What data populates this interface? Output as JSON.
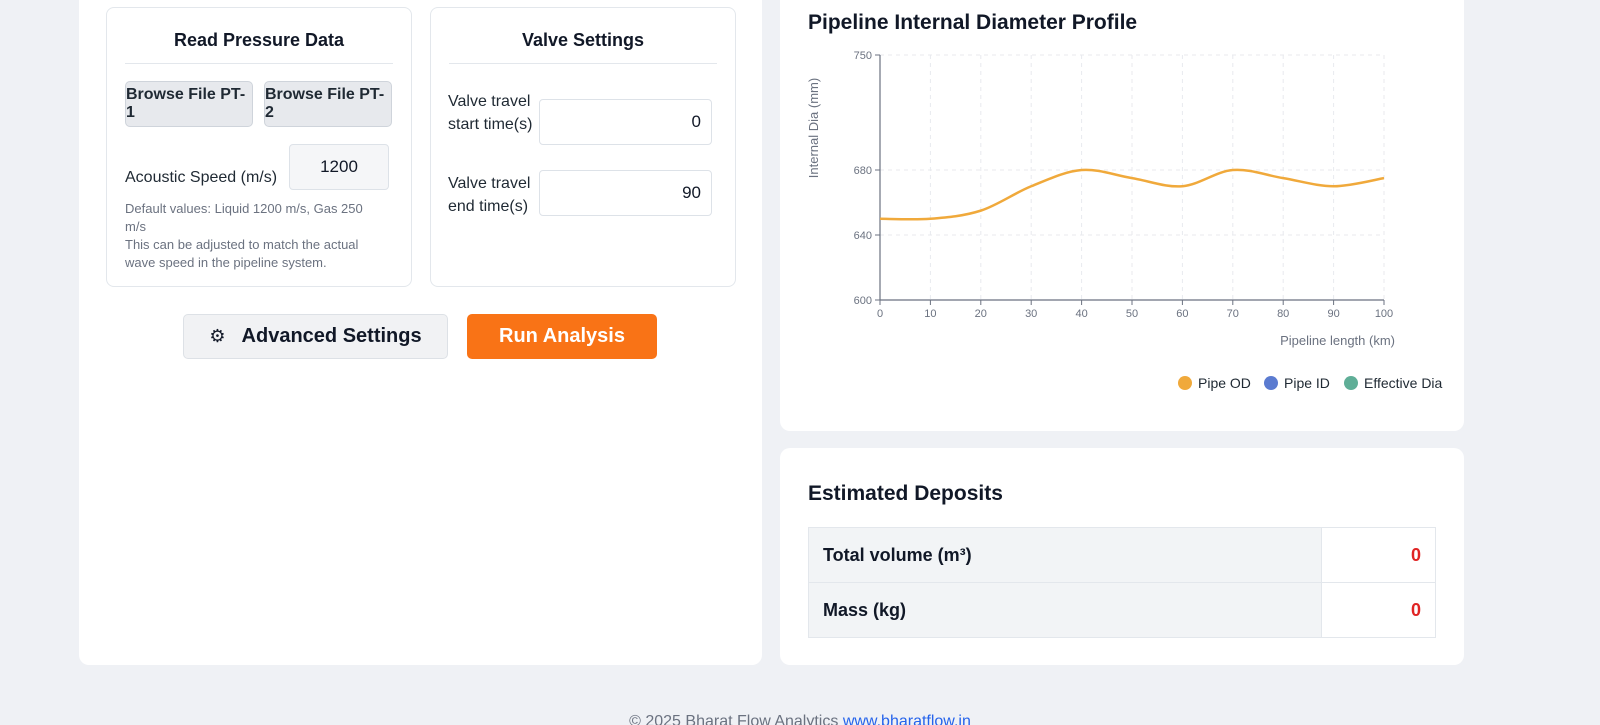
{
  "pressure": {
    "title": "Read Pressure Data",
    "browse_pt1": "Browse File PT-1",
    "browse_pt2": "Browse File PT-2",
    "acoustic_label": "Acoustic Speed (m/s)",
    "acoustic_value": "1200",
    "help_line1": "Default values: Liquid 1200 m/s, Gas 250 m/s",
    "help_line2": "This can be adjusted to match the actual wave speed in the pipeline system."
  },
  "valve": {
    "title": "Valve Settings",
    "start_label": "Valve travel start time(s)",
    "start_value": "0",
    "end_label": "Valve travel end time(s)",
    "end_value": "90"
  },
  "actions": {
    "advanced_label": "Advanced Settings",
    "run_label": "Run Analysis"
  },
  "icons": {
    "advanced": "gear-icon"
  },
  "colors": {
    "accent": "#f97316",
    "pipe_od": "#f0a93b",
    "pipe_id": "#5b7bd0",
    "effective_dia": "#5fae97",
    "deposit_value": "#e02424"
  },
  "chart_data": {
    "type": "line",
    "title": "Pipeline Internal Diameter Profile",
    "xlabel": "Pipeline length (km)",
    "ylabel": "Internal Dia (mm)",
    "xlim": [
      0,
      100
    ],
    "ylim": [
      600,
      750
    ],
    "xticks": [
      0,
      10,
      20,
      30,
      40,
      50,
      60,
      70,
      80,
      90,
      100
    ],
    "yticks": [
      600,
      640,
      680,
      750
    ],
    "grid": true,
    "legend_position": "bottom-right",
    "x": [
      0,
      10,
      20,
      30,
      40,
      50,
      60,
      70,
      80,
      90,
      100
    ],
    "series": [
      {
        "name": "Pipe OD",
        "values": [
          650,
          650,
          655,
          670,
          680,
          675,
          670,
          680,
          675,
          670,
          675
        ]
      },
      {
        "name": "Pipe ID",
        "values": []
      },
      {
        "name": "Effective Dia",
        "values": []
      }
    ]
  },
  "deposits": {
    "title": "Estimated Deposits",
    "rows": [
      {
        "label": "Total volume (m³)",
        "value": "0"
      },
      {
        "label": "Mass (kg)",
        "value": "0"
      }
    ]
  },
  "footer": {
    "text": "© 2025 Bharat Flow Analytics",
    "link": "www.bharatflow.in"
  }
}
